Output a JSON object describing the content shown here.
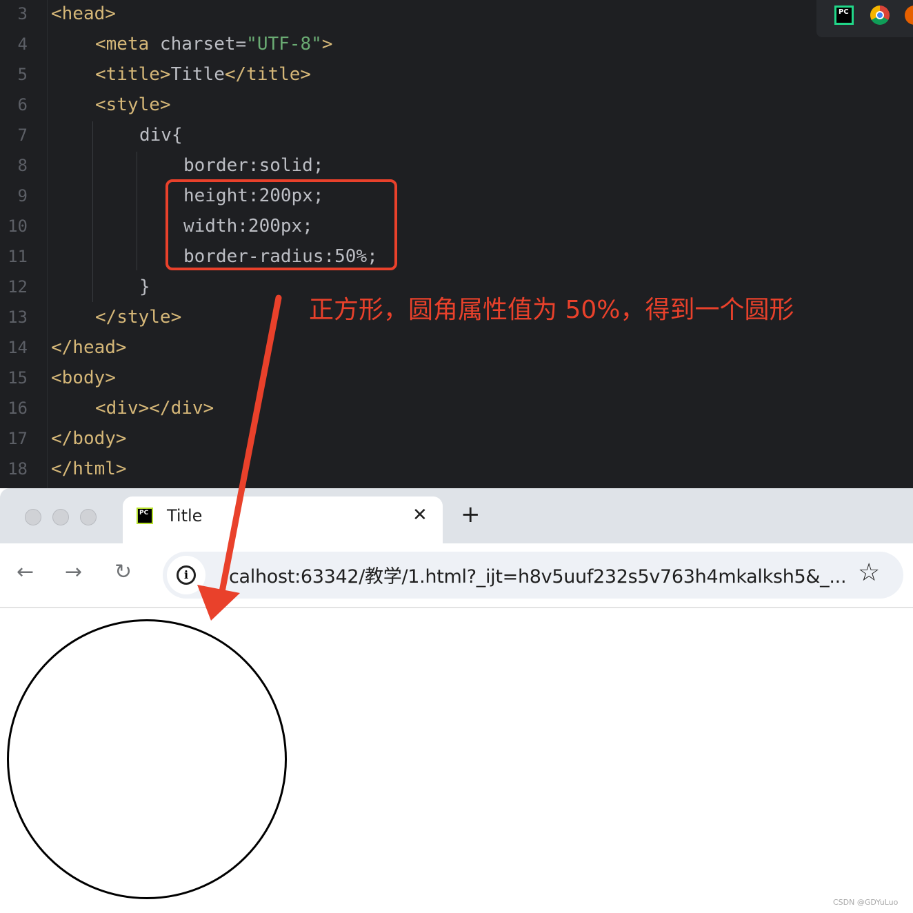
{
  "editor": {
    "lines": [
      {
        "num": "3",
        "parts": [
          {
            "t": "<head>",
            "c": "tag"
          }
        ]
      },
      {
        "num": "4",
        "parts": [
          {
            "t": "<meta",
            "c": "tag"
          },
          {
            "t": " charset=",
            "c": "attr"
          },
          {
            "t": "\"UTF-8\"",
            "c": "str"
          },
          {
            "t": ">",
            "c": "tag"
          }
        ]
      },
      {
        "num": "5",
        "parts": [
          {
            "t": "<title>",
            "c": "tag"
          },
          {
            "t": "Title",
            "c": "attr"
          },
          {
            "t": "</title>",
            "c": "tag"
          }
        ]
      },
      {
        "num": "6",
        "parts": [
          {
            "t": "<style>",
            "c": "tag"
          }
        ]
      },
      {
        "num": "7",
        "parts": [
          {
            "t": "div{",
            "c": "attr"
          }
        ]
      },
      {
        "num": "8",
        "parts": [
          {
            "t": "border:solid;",
            "c": "attr"
          }
        ]
      },
      {
        "num": "9",
        "parts": [
          {
            "t": "height:200px;",
            "c": "attr"
          }
        ]
      },
      {
        "num": "10",
        "parts": [
          {
            "t": "width:200px;",
            "c": "attr"
          }
        ]
      },
      {
        "num": "11",
        "parts": [
          {
            "t": "border-radius:50%;",
            "c": "attr"
          }
        ]
      },
      {
        "num": "12",
        "parts": [
          {
            "t": "}",
            "c": "attr"
          }
        ]
      },
      {
        "num": "13",
        "parts": [
          {
            "t": "</style>",
            "c": "tag"
          }
        ]
      },
      {
        "num": "14",
        "parts": [
          {
            "t": "</head>",
            "c": "tag"
          }
        ]
      },
      {
        "num": "15",
        "parts": [
          {
            "t": "<body>",
            "c": "tag"
          }
        ]
      },
      {
        "num": "16",
        "parts": [
          {
            "t": "<div></div>",
            "c": "tag"
          }
        ]
      },
      {
        "num": "17",
        "parts": [
          {
            "t": "</body>",
            "c": "tag"
          }
        ]
      },
      {
        "num": "18",
        "parts": [
          {
            "t": "</html>",
            "c": "tag"
          }
        ]
      }
    ],
    "annotation": "正方形，圆角属性值为 50%，得到一个圆形",
    "annotation_color": "#e9412b",
    "topbar_icons": [
      "pycharm-icon",
      "chrome-icon",
      "firefox-icon"
    ]
  },
  "browser": {
    "tab_title": "Title",
    "tab_close": "✕",
    "new_tab": "+",
    "back": "←",
    "forward": "→",
    "reload": "↻",
    "info": "i",
    "url": "calhost:63342/教学/1.html?_ijt=h8v5uuf232s5v763h4mkalksh5&_...",
    "bookmark": "☆",
    "favicon_text": "PC"
  },
  "watermark": "CSDN @GDYuLuo"
}
